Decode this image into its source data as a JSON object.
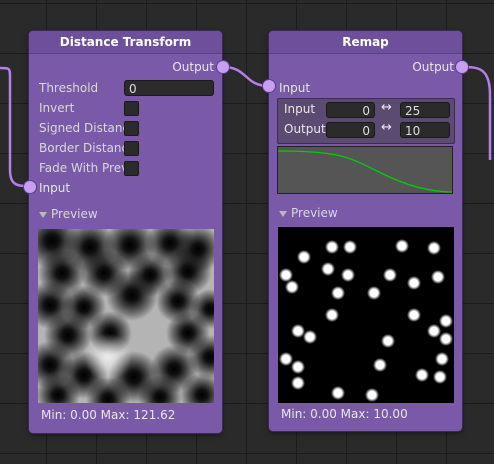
{
  "node_distance": {
    "title": "Distance Transform",
    "output_label": "Output",
    "input_label": "Input",
    "fields": [
      {
        "label": "Threshold",
        "value": "0"
      },
      {
        "label": "Invert"
      },
      {
        "label": "Signed Distance"
      },
      {
        "label": "Border Distance"
      },
      {
        "label": "Fade With Prev"
      }
    ],
    "preview_label": "Preview",
    "stats": "Min: 0.00 Max: 121.62"
  },
  "node_remap": {
    "title": "Remap",
    "output_label": "Output",
    "input_label": "Input",
    "input_row": {
      "label": "Input",
      "from": "0",
      "to": "25"
    },
    "output_row": {
      "label": "Output",
      "from": "0",
      "to": "10"
    },
    "arrow_symbol": "↔",
    "preview_label": "Preview",
    "stats": "Min: 0.00 Max: 10.00"
  },
  "colors": {
    "node_body": "#7a5aa8",
    "port": "#c89ef0",
    "wire": "#b67ee8",
    "curve": "#00d000"
  }
}
